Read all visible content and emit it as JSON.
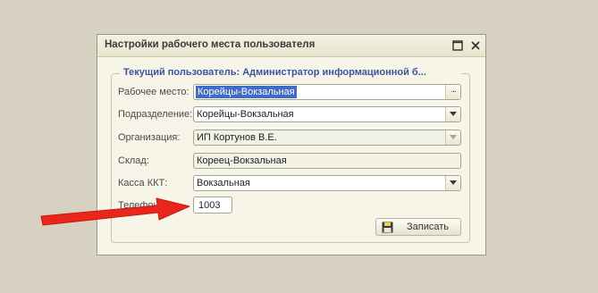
{
  "window": {
    "title": "Настройки рабочего места пользователя"
  },
  "group": {
    "legend": "Текущий пользователь: Администратор информационной б..."
  },
  "fields": {
    "workplace": {
      "label": "Рабочее место:",
      "value": "Корейцы-Вокзальная"
    },
    "division": {
      "label": "Подразделение:",
      "value": "Корейцы-Вокзальная"
    },
    "organization": {
      "label": "Организация:",
      "value": "ИП Кортунов В.Е."
    },
    "warehouse": {
      "label": "Склад:",
      "value": "Кореец-Вокзальная"
    },
    "cashbox": {
      "label": "Касса ККТ:",
      "value": "Вокзальная"
    },
    "phone": {
      "label": "Телефон:",
      "value": "1003"
    }
  },
  "buttons": {
    "save": "Записать"
  },
  "colors": {
    "arrow": "#e8261b",
    "accent": "#3b54a0",
    "selection": "#3f6bc4"
  },
  "icons": {
    "maximize": "maximize-icon",
    "close": "close-icon",
    "dropdown": "chevron-down-icon",
    "ellipsis": "ellipsis-icon",
    "save": "floppy-disk-icon"
  }
}
